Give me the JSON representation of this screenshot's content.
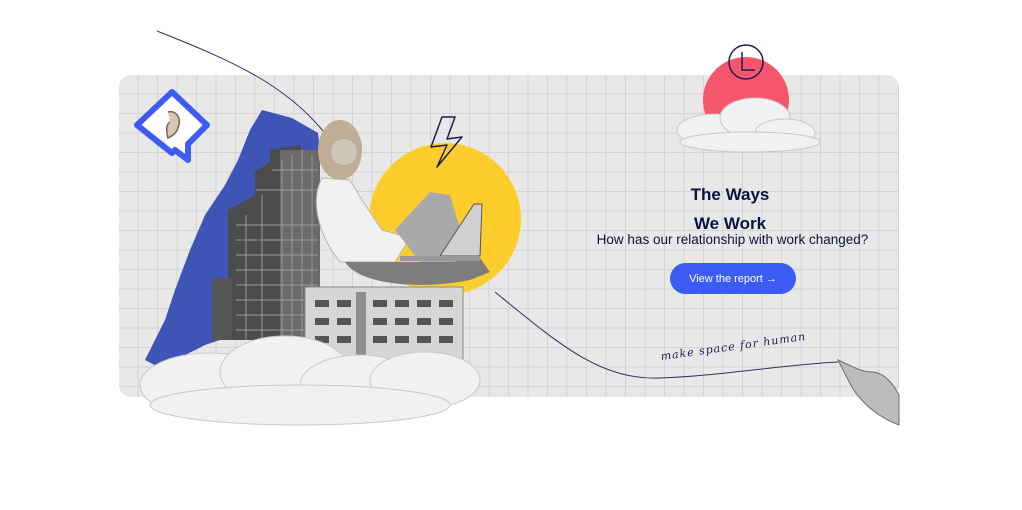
{
  "hero": {
    "title_line1": "The Ways",
    "title_line2": "We Work",
    "subtitle": "How has our relationship with work changed?",
    "cta_label": "View the report →",
    "handwritten_note": "make space for human"
  },
  "colors": {
    "card_background": "#e8e8e8",
    "grid_lines": "#d3d3d3",
    "accent_blue": "#3d5cf5",
    "sun_yellow": "#fdcd2e",
    "sun_red": "#f5566b",
    "headline_navy": "#0e1140",
    "torn_paper_blue": "#3f55b5"
  },
  "icons": [
    "speech-bubble-ear-icon",
    "lightning-icon",
    "clock-icon",
    "cloud-icon",
    "pointing-hand-icon"
  ]
}
